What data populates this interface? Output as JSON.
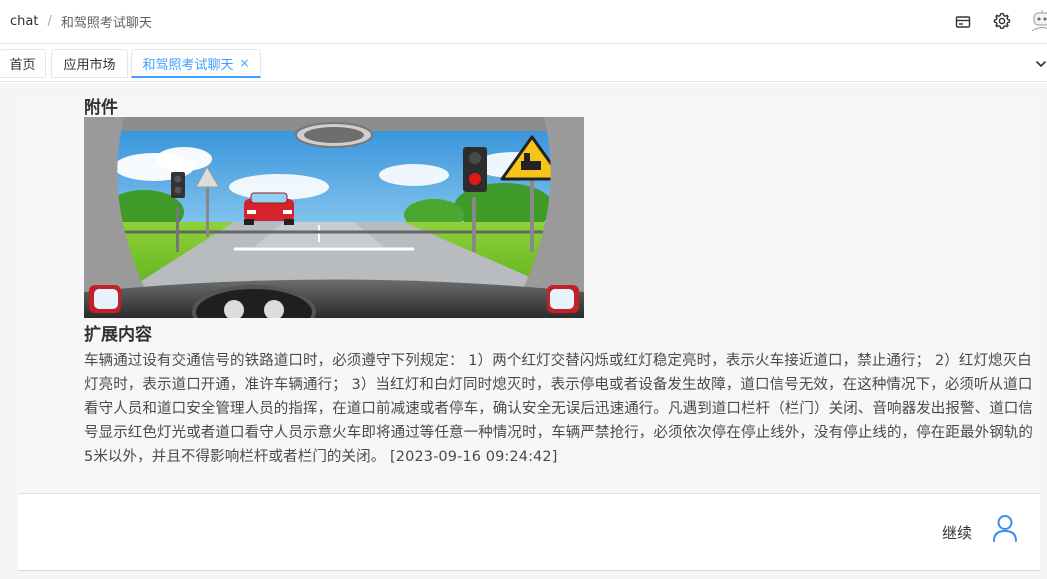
{
  "breadcrumb": {
    "root": "chat",
    "separator": "/",
    "current": "和驾照考试聊天"
  },
  "header_icons": [
    "card-icon",
    "gear-icon",
    "avatar-icon"
  ],
  "tabs": [
    {
      "label": "首页",
      "active": false
    },
    {
      "label": "应用市场",
      "active": false
    },
    {
      "label": "和驾照考试聊天",
      "active": true,
      "close": "×"
    }
  ],
  "message": {
    "attachment_title": "附件",
    "extension_title": "扩展内容",
    "content": "车辆通过设有交通信号的铁路道口时，必须遵守下列规定： 1）两个红灯交替闪烁或红灯稳定亮时，表示火车接近道口，禁止通行； 2）红灯熄灭白灯亮时，表示道口开通，准许车辆通行； 3）当红灯和白灯同时熄灭时，表示停电或者设备发生故障，道口信号无效，在这种情况下，必须听从道口看守人员和道口安全管理人员的指挥，在道口前减速或者停车，确认安全无误后迅速通行。凡遇到道口栏杆（栏门）关闭、音响器发出报警、道口信号显示红色灯光或者道口看守人员示意火车即将通过等任意一种情况时，车辆严禁抢行，必须依次停在停止线外，没有停止线的，停在距最外钢轨的5米以外，并且不得影响栏杆或者栏门的关闭。",
    "timestamp": "[2023-09-16 09:24:42]"
  },
  "actions": {
    "continue_label": "继续"
  },
  "colors": {
    "accent": "#409eff",
    "user_icon": "#3a8ee6"
  }
}
